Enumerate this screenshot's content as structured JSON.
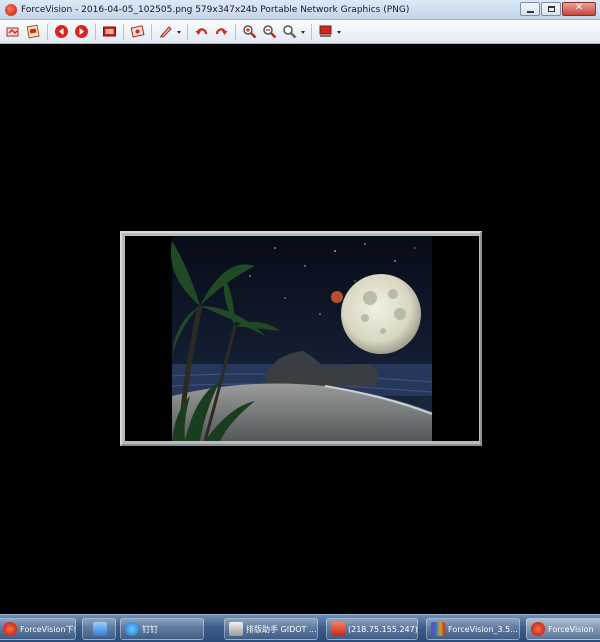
{
  "window": {
    "title": "ForceVision - 2016-04-05_102505.png  579x347x24b  Portable Network Graphics (PNG)"
  },
  "window_controls": {
    "minimize_icon": "minimize-icon",
    "maximize_icon": "maximize-icon",
    "close_icon": "close-icon",
    "close_glyph": "✕"
  },
  "toolbar": {
    "buttons": [
      {
        "name": "open-icon"
      },
      {
        "name": "save-icon"
      },
      {
        "name": "previous-icon"
      },
      {
        "name": "next-icon"
      },
      {
        "name": "fullscreen-icon"
      },
      {
        "name": "slideshow-icon"
      },
      {
        "name": "edit-pen-icon"
      },
      {
        "name": "undo-icon"
      },
      {
        "name": "redo-icon"
      },
      {
        "name": "zoom-in-icon"
      },
      {
        "name": "zoom-out-icon"
      },
      {
        "name": "zoom-icon"
      },
      {
        "name": "color-icon"
      }
    ],
    "accent_color": "#d0281c"
  },
  "image": {
    "description_colors": {
      "sky": "#0b1426",
      "moon": "#e9e6d3",
      "sand": "#7d7f7f"
    }
  },
  "taskbar": {
    "items": [
      {
        "label": "ForceVision下载...",
        "icon": "forcevision-icon"
      },
      {
        "label": "",
        "icon": "bird-icon"
      },
      {
        "label": "钉钉",
        "icon": "dingtalk-icon"
      },
      {
        "label": "排版助手 GIDOT ...",
        "icon": "gidot-icon"
      },
      {
        "label": "(218.75.155.247)...",
        "icon": "remote-icon"
      },
      {
        "label": "ForceVision_3.5...",
        "icon": "winrar-icon"
      },
      {
        "label": "ForceVision",
        "icon": "forcevision-icon"
      }
    ]
  }
}
